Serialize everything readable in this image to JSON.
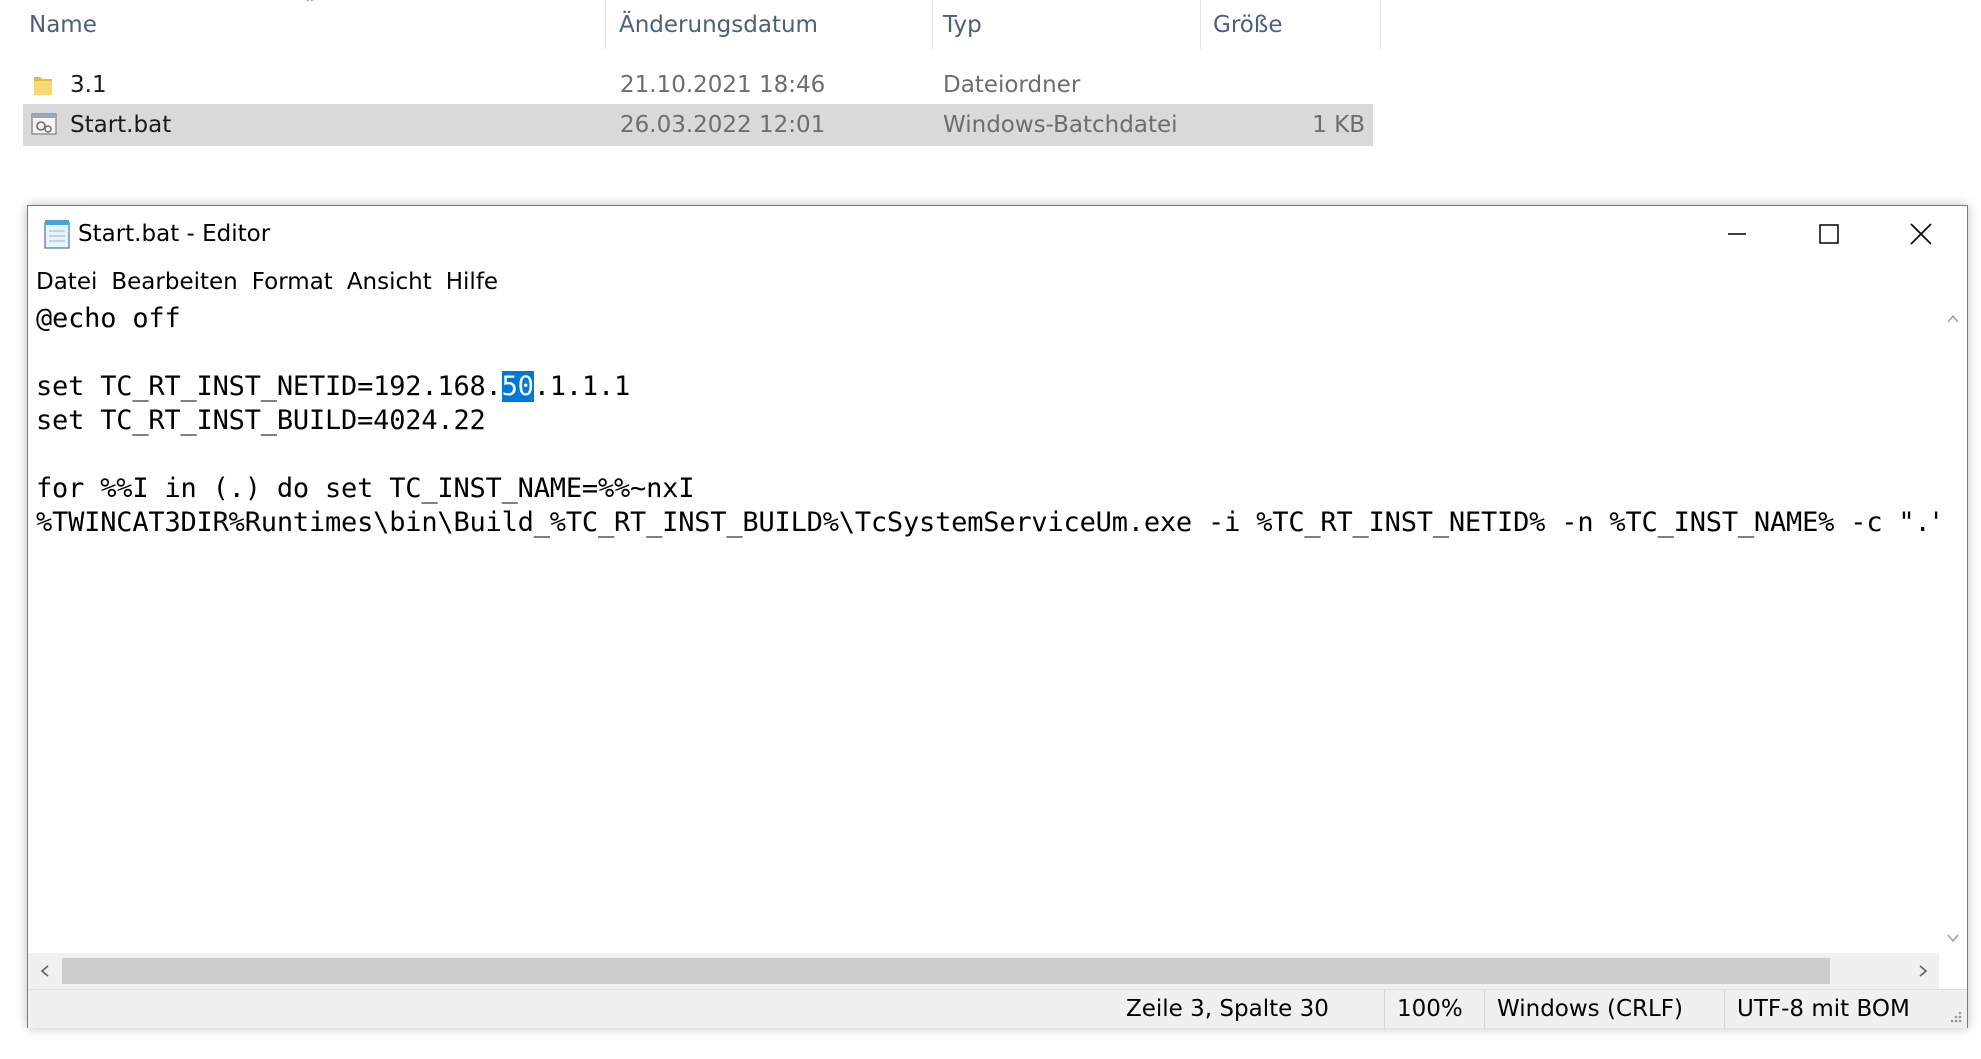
{
  "explorer": {
    "columns": {
      "name": "Name",
      "date": "Änderungsdatum",
      "type": "Typ",
      "size": "Größe"
    },
    "files": [
      {
        "name": "3.1",
        "date": "21.10.2021 18:46",
        "type": "Dateiordner",
        "size": "",
        "icon": "folder-icon",
        "selected": false
      },
      {
        "name": "Start.bat",
        "date": "26.03.2022 12:01",
        "type": "Windows-Batchdatei",
        "size": "1 KB",
        "icon": "batch-file-icon",
        "selected": true
      }
    ]
  },
  "notepad": {
    "title": "Start.bat - Editor",
    "menu": [
      "Datei",
      "Bearbeiten",
      "Format",
      "Ansicht",
      "Hilfe"
    ],
    "content": {
      "line1": "@echo off",
      "line2": "",
      "line3_before": "set TC_RT_INST_NETID=192.168.",
      "line3_selected": "50",
      "line3_after": ".1.1.1",
      "line4": "set TC_RT_INST_BUILD=4024.22",
      "line5": "",
      "line6": "for %%I in (.) do set TC_INST_NAME=%%~nxI",
      "line7": "%TWINCAT3DIR%Runtimes\\bin\\Build_%TC_RT_INST_BUILD%\\TcSystemServiceUm.exe -i %TC_RT_INST_NETID% -n %TC_INST_NAME% -c \".\""
    },
    "status": {
      "position": "Zeile 3, Spalte 30",
      "zoom": "100%",
      "line_ending": "Windows (CRLF)",
      "encoding": "UTF-8 mit BOM"
    },
    "colors": {
      "selection": "#0078d7",
      "selected_row": "#d9d9d9"
    }
  }
}
